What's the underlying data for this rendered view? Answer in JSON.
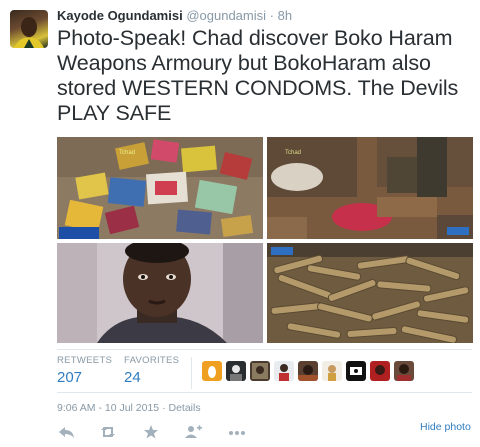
{
  "tweet": {
    "author_name": "Kayode Ogundamisi",
    "author_handle": "@ogundamisi",
    "separator": "·",
    "relative_time": "8h",
    "text": "Photo-Speak! Chad discover Boko Haram Weapons Armoury but BokoHaram also stored WESTERN CONDOMS. The Devils PLAY SAFE",
    "photos": [
      {
        "icon": "condom-packets-photo",
        "watermark": "Tchad"
      },
      {
        "icon": "packets-on-ground-photo",
        "watermark": "Tchad"
      },
      {
        "icon": "man-portrait-photo",
        "watermark": ""
      },
      {
        "icon": "ammunition-pile-photo",
        "watermark": ""
      }
    ]
  },
  "stats": {
    "retweets_label": "RETWEETS",
    "retweets_count": "207",
    "favorites_label": "FAVORITES",
    "favorites_count": "24"
  },
  "timestamp": {
    "date": "9:06 AM - 10 Jul 2015",
    "separator": "·",
    "details_label": "Details"
  },
  "actions": {
    "reply": "reply-icon",
    "retweet": "retweet-icon",
    "favorite": "star-icon",
    "follow": "follow-icon",
    "more": "more-icon",
    "hide_photo_label": "Hide photo"
  },
  "colors": {
    "link": "#2f7dc0",
    "muted": "#8899a6",
    "text": "#292f33",
    "divider": "#e1e8ed"
  }
}
